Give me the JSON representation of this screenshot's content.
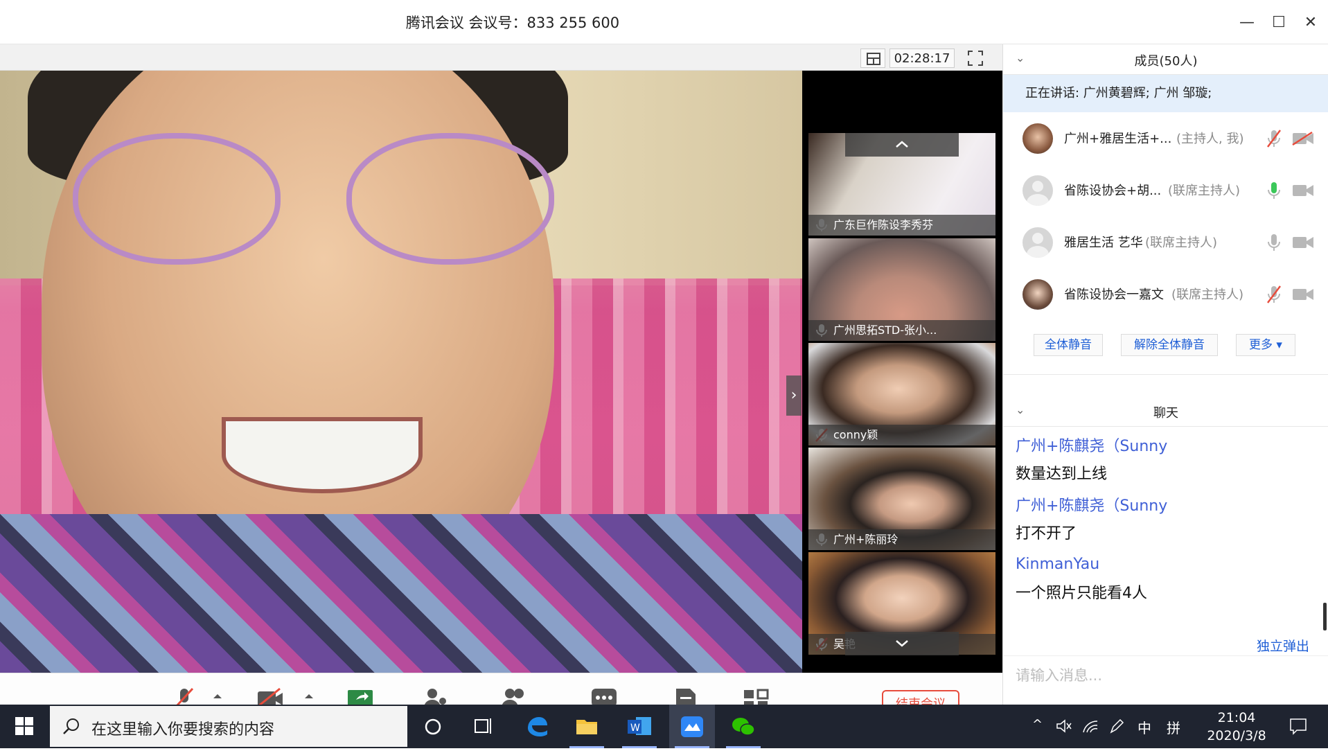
{
  "window": {
    "title": "腾讯会议 会议号：833 255 600",
    "minimize_label": "—",
    "maximize_label": "☐",
    "close_label": "✕"
  },
  "video_header": {
    "timer": "02:28:17"
  },
  "thumbnails": [
    {
      "name": "广东巨作陈设李秀芬",
      "muted": false
    },
    {
      "name": "广州思拓STD-张小...",
      "muted": false
    },
    {
      "name": "conny颖",
      "muted": true
    },
    {
      "name": "广州+陈丽玲",
      "muted": false
    },
    {
      "name": "吴艳",
      "muted": true
    }
  ],
  "toolbar": {
    "end_meeting_label": "结束会议"
  },
  "members": {
    "header": "成员(50人)",
    "speaking": "正在讲话: 广州黄碧辉; 广州 邹璇;",
    "list": [
      {
        "name": "广州+雅居生活+...",
        "role": "(主持人, 我)",
        "mic": "muted",
        "cam": "off"
      },
      {
        "name": "省陈设协会+胡...",
        "role": "(联席主持人)",
        "mic": "active",
        "cam": "on"
      },
      {
        "name": "雅居生活 艺华",
        "role": "(联席主持人)",
        "mic": "on",
        "cam": "on"
      },
      {
        "name": "省陈设协会一嘉文",
        "role": "(联席主持人)",
        "mic": "muted",
        "cam": "on"
      }
    ],
    "mute_all_label": "全体静音",
    "unmute_all_label": "解除全体静音",
    "more_label": "更多 ▾"
  },
  "chat": {
    "header": "聊天",
    "messages": [
      {
        "sender": "广州+陈麒尧（Sunny",
        "text": "数量达到上线"
      },
      {
        "sender": "广州+陈麒尧（Sunny",
        "text": "打不开了"
      },
      {
        "sender": "KinmanYau",
        "text": "一个照片只能看4人"
      }
    ],
    "popout_label": "独立弹出",
    "input_placeholder": "请输入消息..."
  },
  "taskbar": {
    "search_placeholder": "在这里输入你要搜索的内容",
    "ime_lang": "中",
    "ime_mode": "拼",
    "time": "21:04",
    "date": "2020/3/8"
  },
  "colors": {
    "accent_blue": "#1f5fd6",
    "sender_blue": "#3f5fd6",
    "muted_red": "#e74c3c",
    "mic_green": "#3cc85a",
    "taskbar_bg": "#1f2430",
    "speaking_bg": "#e4effb"
  }
}
